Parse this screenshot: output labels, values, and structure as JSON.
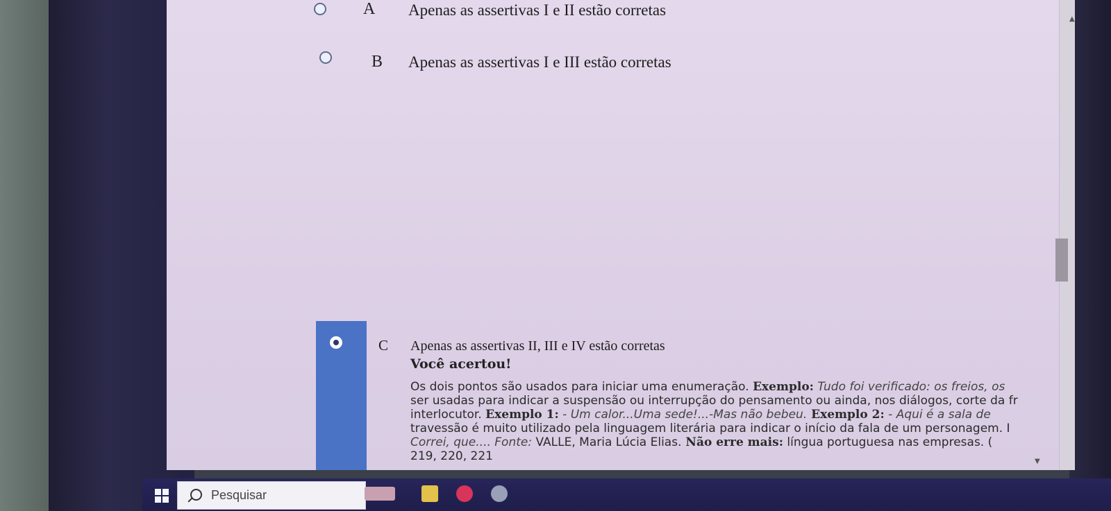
{
  "options": [
    {
      "letter": "A",
      "text": "Apenas as assertivas I e II estão corretas",
      "selected": false
    },
    {
      "letter": "B",
      "text": "Apenas as assertivas I e III estão corretas",
      "selected": false
    },
    {
      "letter": "C",
      "text": "Apenas as assertivas II, III e IV estão corretas",
      "selected": true
    }
  ],
  "feedback": {
    "title": "Você acertou!",
    "lines": [
      {
        "normal": "Os dois pontos são usados para iniciar uma enumeração. ",
        "bold": "Exemplo:",
        "italic": " Tudo foi verificado: os freios, os"
      },
      {
        "normal": "ser usadas para indicar a suspensão ou interrupção do pensamento ou ainda, nos diálogos, corte da fr",
        "bold": "",
        "italic": ""
      },
      {
        "normal": "interlocutor. ",
        "bold": "Exemplo 1:",
        "italic": " - Um calor...Uma sede!...-Mas não bebeu.",
        "tail_bold": " Exemplo 2:",
        "tail_italic": " - Aqui é a sala de"
      },
      {
        "normal": "travessão é muito utilizado pela linguagem literária para indicar o início da fala de um personagem. I",
        "bold": "",
        "italic": ""
      },
      {
        "normal": "",
        "bold": "",
        "italic": "Correi, que.... Fonte:",
        "tail_normal": " VALLE, Maria Lúcia Elias.",
        "tail_bold": " Não erre mais:",
        "tail_end": " língua portuguesa nas empresas. ("
      },
      {
        "normal": "219, 220, 221",
        "bold": "",
        "italic": ""
      }
    ]
  },
  "taskbar": {
    "search_placeholder": "Pesquisar"
  },
  "colors": {
    "correct_bar": "#4a73c6",
    "taskbar": "#27255a"
  }
}
